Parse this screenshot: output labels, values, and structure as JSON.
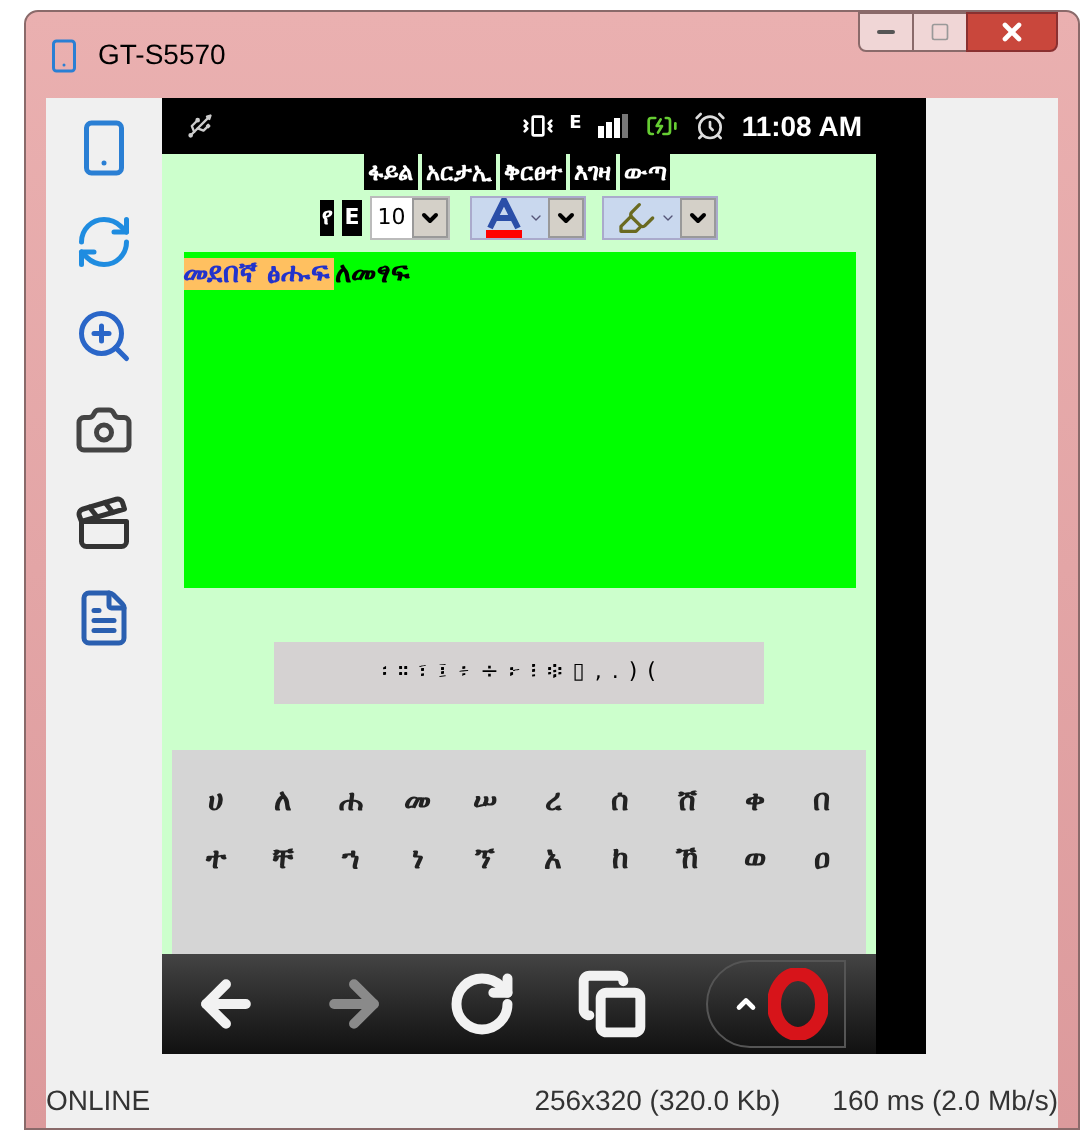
{
  "window": {
    "title": "GT-S5570"
  },
  "phone_status": {
    "network": "E",
    "time": "11:08 AM"
  },
  "menu": [
    {
      "label": "ፋይል"
    },
    {
      "label": "አርታኢ"
    },
    {
      "label": "ቅርፀተ"
    },
    {
      "label": "እገዛ"
    },
    {
      "label": "ውጣ"
    }
  ],
  "toolbar": {
    "script_buttons": [
      {
        "label": "የ"
      },
      {
        "label": "E"
      }
    ],
    "font_size": "10"
  },
  "editor": {
    "segments": [
      {
        "text": "መደበኛ ፅሑፍ",
        "highlighted": true
      },
      {
        "text": "ለመፃፍ",
        "highlighted": false
      }
    ]
  },
  "punctuation": [
    "፡",
    "።",
    "፣",
    "፤",
    "፥",
    "÷",
    "፦",
    "፧",
    "፨",
    "▯",
    ",",
    ".",
    ")",
    "("
  ],
  "keyboard": [
    [
      "ሀ",
      "ለ",
      "ሐ",
      "መ",
      "ሠ",
      "ረ",
      "ሰ",
      "ሸ",
      "ቀ",
      "በ"
    ],
    [
      "ተ",
      "ቸ",
      "ኀ",
      "ነ",
      "ኘ",
      "አ",
      "ከ",
      "ኸ",
      "ወ",
      "ዐ"
    ]
  ],
  "nav_buttons": [
    {
      "kind": "back",
      "disabled": false
    },
    {
      "kind": "forward",
      "disabled": true
    },
    {
      "kind": "reload",
      "disabled": false
    },
    {
      "kind": "tabs",
      "disabled": false
    },
    {
      "kind": "menu",
      "disabled": false
    }
  ],
  "status_bar": {
    "connection": "ONLINE",
    "screen": "256x320 (320.0 Kb)",
    "speed": "160 ms (2.0 Mb/s)"
  }
}
